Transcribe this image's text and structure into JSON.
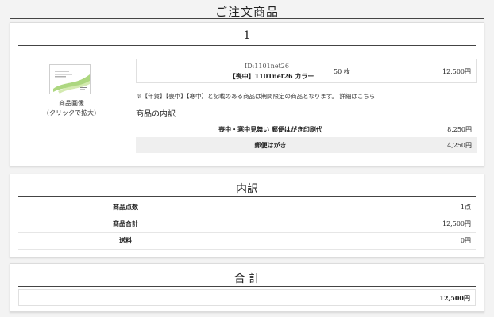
{
  "page_title": "ご注文商品",
  "order": {
    "index": "1",
    "thumbnail_label_line1": "商品画像",
    "thumbnail_label_line2": "(クリックで拡大)",
    "item": {
      "id": "ID:1101net26",
      "name": "【喪中】1101net26  カラー",
      "quantity": "50  枚",
      "price": "12,500円"
    },
    "notice_text": "※【年賀】【喪中】【寒中】と記載のある商品は期間限定の商品となります。",
    "notice_link": "詳細はこちら",
    "sub_heading": "商品の内訳",
    "sub_items": [
      {
        "name": "喪中・寒中見舞い 郵便はがき印刷代",
        "price": "8,250円"
      },
      {
        "name": "郵便はがき",
        "price": "4,250円"
      }
    ]
  },
  "breakdown": {
    "title": "内訳",
    "rows": [
      {
        "label": "商品点数",
        "value": "1点"
      },
      {
        "label": "商品合計",
        "value": "12,500円"
      },
      {
        "label": "送料",
        "value": "0円"
      }
    ]
  },
  "total": {
    "title": "合 計",
    "value": "12,500円"
  },
  "colors": {
    "accent": "#8fc25a",
    "border": "#dcdcdc",
    "row_alt": "#efefef"
  }
}
